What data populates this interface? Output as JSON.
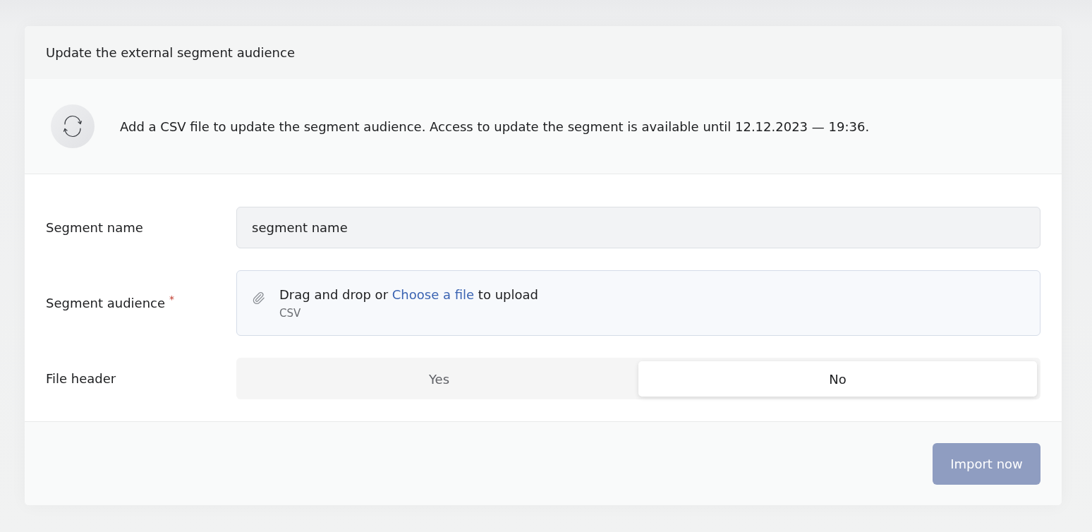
{
  "dialog": {
    "title": "Update the external segment audience"
  },
  "notice": {
    "text": "Add a CSV file to update the segment audience. Access to update the segment is available until 12.12.2023 — 19:36."
  },
  "fields": [
    {
      "kind": "text",
      "label": "Segment name",
      "value": "segment name"
    },
    {
      "kind": "upload",
      "label": "Segment audience",
      "required_mark": "*",
      "text_before": "Drag and drop or",
      "link": "Choose a file",
      "text_after": "to upload",
      "hint": "CSV"
    },
    {
      "kind": "toggle",
      "label": "File header",
      "options": [
        {
          "label": "Yes",
          "selected": false
        },
        {
          "label": "No",
          "selected": true
        }
      ]
    }
  ],
  "footer": {
    "button": {
      "label": "Import now",
      "disabled": true
    }
  }
}
